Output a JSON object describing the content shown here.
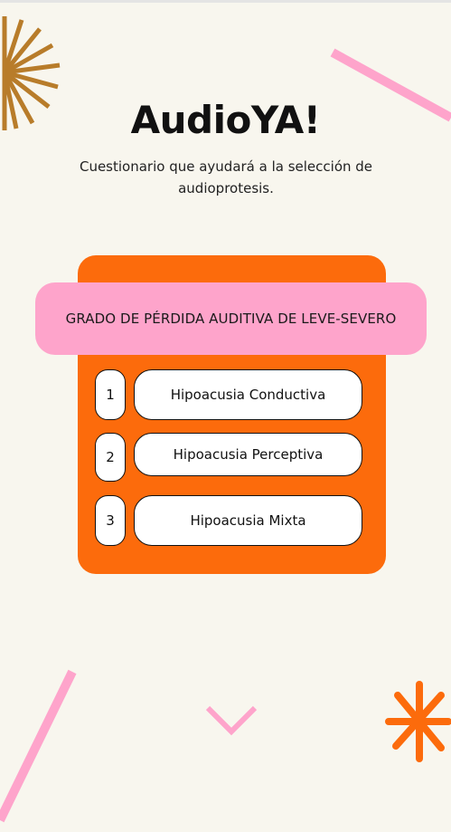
{
  "app": {
    "title": "AudioYA!",
    "subtitle": "Cuestionario que ayudará a la selección de audioprotesis."
  },
  "question": {
    "heading": "GRADO DE PÉRDIDA AUDITIVA DE LEVE-SEVERO",
    "options": [
      {
        "number": "1",
        "label": "Hipoacusia Conductiva"
      },
      {
        "number": "2",
        "label": "Hipoacusia Perceptiva"
      },
      {
        "number": "3",
        "label": "Hipoacusia Mixta"
      }
    ]
  },
  "icons": {
    "top_left": "sunburst-icon",
    "bottom_right": "asterisk-icon",
    "scroll": "chevron-down-icon"
  },
  "colors": {
    "background": "#f8f6ee",
    "card": "#fc6b0c",
    "banner": "#fea4cb",
    "sunburst": "#b87c2a",
    "pink_stroke": "#fea4cb",
    "orange_asterisk": "#fc6b0c"
  }
}
